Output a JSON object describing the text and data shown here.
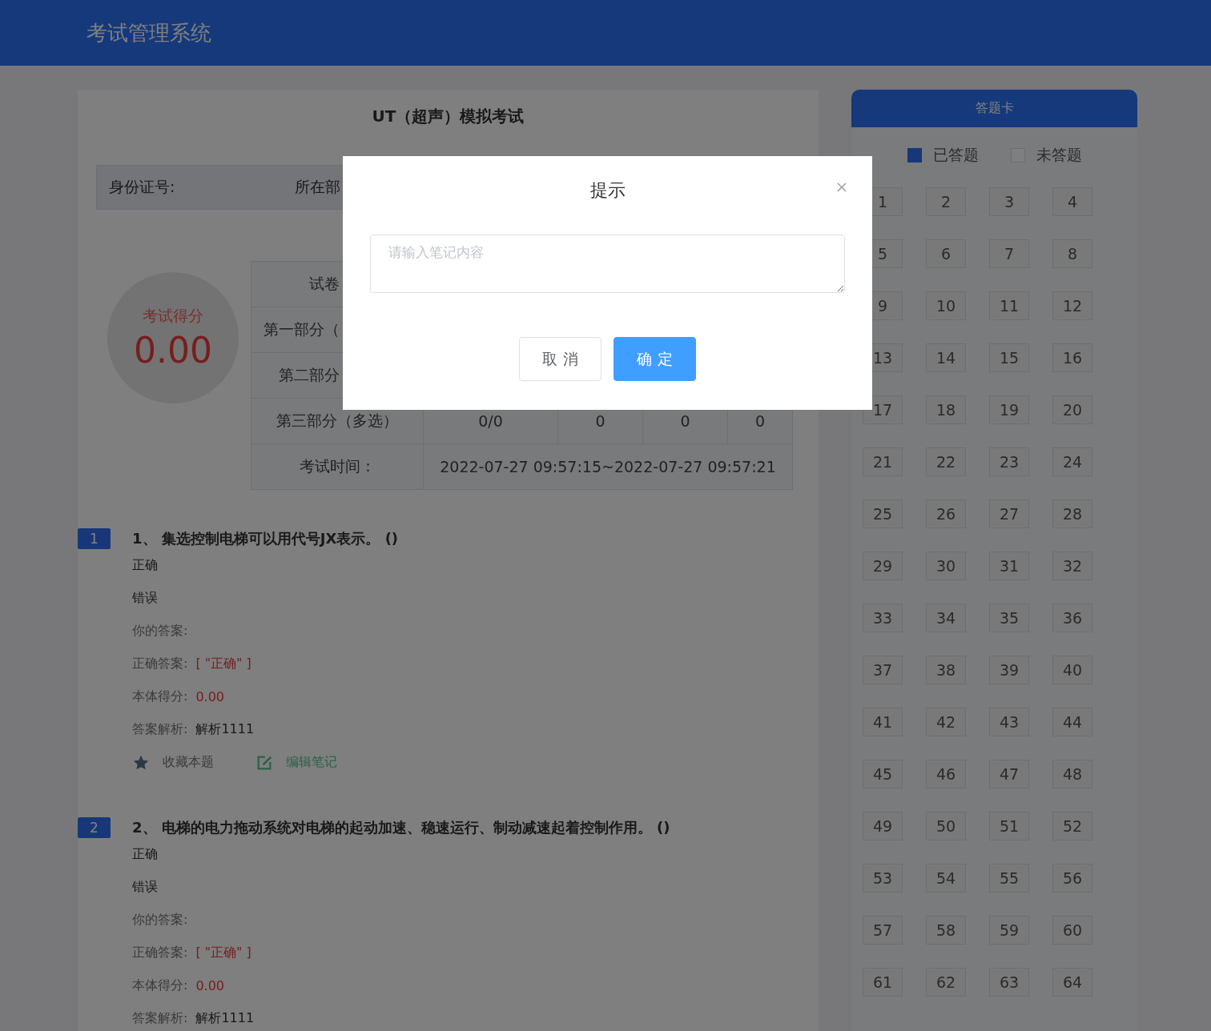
{
  "header": {
    "title": "考试管理系统"
  },
  "exam": {
    "title": "UT（超声）模拟考试",
    "info": [
      {
        "label": "身份证号:"
      },
      {
        "label": "所在部"
      }
    ],
    "score": {
      "label": "考试得分",
      "value": "0.00"
    },
    "summary_rows": [
      {
        "cells": [
          "试卷"
        ]
      },
      {
        "cells": [
          "第一部分（"
        ]
      },
      {
        "cells": [
          "第二部分"
        ]
      },
      {
        "cells": [
          "第三部分（多选）",
          "0/0",
          "0",
          "0",
          "0"
        ]
      },
      {
        "cells": [
          "考试时间：",
          "2022-07-27 09:57:15~2022-07-27 09:57:21"
        ]
      }
    ]
  },
  "questions": [
    {
      "number": "1",
      "title": "1、 集选控制电梯可以用代号JX表示。 ()",
      "options": [
        "正确",
        "错误"
      ],
      "your_answer_label": "你的答案:",
      "correct_label": "正确答案:",
      "correct_value": "[ \"正确\" ]",
      "score_label": "本体得分:",
      "score_value": "0.00",
      "analysis_label": "答案解析:",
      "analysis_value": "解析1111",
      "actions": [
        {
          "kind": "favorite",
          "label": "收藏本题"
        },
        {
          "kind": "note",
          "label": "编辑笔记"
        }
      ]
    },
    {
      "number": "2",
      "title": "2、 电梯的电力拖动系统对电梯的起动加速、稳速运行、制动减速起着控制作用。 ()",
      "options": [
        "正确",
        "错误"
      ],
      "your_answer_label": "你的答案:",
      "correct_label": "正确答案:",
      "correct_value": "[ \"正确\" ]",
      "score_label": "本体得分:",
      "score_value": "0.00",
      "analysis_label": "答案解析:",
      "analysis_value": "解析1111"
    }
  ],
  "answer_card": {
    "title": "答题卡",
    "legend": [
      {
        "label": "已答题",
        "answered": true
      },
      {
        "label": "未答题",
        "answered": false
      }
    ],
    "items": [
      {
        "label": "1",
        "answered": false
      },
      {
        "label": "2",
        "answered": false
      },
      {
        "label": "3",
        "answered": false
      },
      {
        "label": "4",
        "answered": false
      },
      {
        "label": "5",
        "answered": false
      },
      {
        "label": "6",
        "answered": false
      },
      {
        "label": "7",
        "answered": false
      },
      {
        "label": "8",
        "answered": false
      },
      {
        "label": "9",
        "answered": false
      },
      {
        "label": "10",
        "answered": false
      },
      {
        "label": "11",
        "answered": false
      },
      {
        "label": "12",
        "answered": false
      },
      {
        "label": "13",
        "answered": false
      },
      {
        "label": "14",
        "answered": false
      },
      {
        "label": "15",
        "answered": false
      },
      {
        "label": "16",
        "answered": false
      },
      {
        "label": "17",
        "answered": false
      },
      {
        "label": "18",
        "answered": false
      },
      {
        "label": "19",
        "answered": false
      },
      {
        "label": "20",
        "answered": false
      },
      {
        "label": "21",
        "answered": false
      },
      {
        "label": "22",
        "answered": false
      },
      {
        "label": "23",
        "answered": false
      },
      {
        "label": "24",
        "answered": false
      },
      {
        "label": "25",
        "answered": false
      },
      {
        "label": "26",
        "answered": false
      },
      {
        "label": "27",
        "answered": false
      },
      {
        "label": "28",
        "answered": false
      },
      {
        "label": "29",
        "answered": false
      },
      {
        "label": "30",
        "answered": false
      },
      {
        "label": "31",
        "answered": false
      },
      {
        "label": "32",
        "answered": false
      },
      {
        "label": "33",
        "answered": false
      },
      {
        "label": "34",
        "answered": false
      },
      {
        "label": "35",
        "answered": false
      },
      {
        "label": "36",
        "answered": false
      },
      {
        "label": "37",
        "answered": false
      },
      {
        "label": "38",
        "answered": false
      },
      {
        "label": "39",
        "answered": false
      },
      {
        "label": "40",
        "answered": false
      },
      {
        "label": "41",
        "answered": false
      },
      {
        "label": "42",
        "answered": false
      },
      {
        "label": "43",
        "answered": false
      },
      {
        "label": "44",
        "answered": false
      },
      {
        "label": "45",
        "answered": false
      },
      {
        "label": "46",
        "answered": false
      },
      {
        "label": "47",
        "answered": false
      },
      {
        "label": "48",
        "answered": false
      },
      {
        "label": "49",
        "answered": false
      },
      {
        "label": "50",
        "answered": false
      },
      {
        "label": "51",
        "answered": false
      },
      {
        "label": "52",
        "answered": false
      },
      {
        "label": "53",
        "answered": false
      },
      {
        "label": "54",
        "answered": false
      },
      {
        "label": "55",
        "answered": false
      },
      {
        "label": "56",
        "answered": false
      },
      {
        "label": "57",
        "answered": false
      },
      {
        "label": "58",
        "answered": false
      },
      {
        "label": "59",
        "answered": false
      },
      {
        "label": "60",
        "answered": false
      },
      {
        "label": "61",
        "answered": false
      },
      {
        "label": "62",
        "answered": false
      },
      {
        "label": "63",
        "answered": false
      },
      {
        "label": "64",
        "answered": false
      }
    ]
  },
  "dialog": {
    "title": "提示",
    "placeholder": "请输入笔记内容",
    "buttons": [
      {
        "label": "取 消",
        "kind": "default"
      },
      {
        "label": "确 定",
        "kind": "primary"
      }
    ]
  }
}
